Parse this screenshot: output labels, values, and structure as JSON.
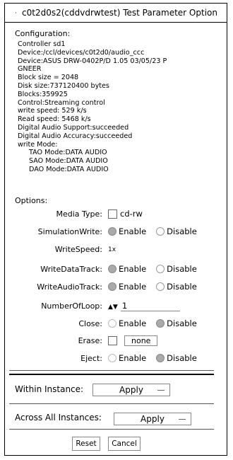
{
  "window": {
    "title": "c0t2d0s2(cddvdrwtest) Test Parameter Option"
  },
  "configuration": {
    "heading": "Configuration:",
    "lines": [
      "Controller sd1",
      "Device:/ccl/devices/c0t2d0/audio_ccc",
      "Device:ASUS    DRW-0402P/D      1.05 03/05/23 P",
      "GNEER",
      "Block size = 2048",
      "Disk size:737120400 bytes",
      "Blocks:359925",
      "Control:Streaming control",
      "write speed: 529 k/s",
      "Read speed: 5468 k/s",
      "Digital Audio Support:succeeded",
      "Digital Audio Accuracy:succeeded",
      "write Mode:",
      "TAO Mode:DATA   AUDIO",
      "SAO Mode:DATA   AUDIO",
      "DAO Mode:DATA   AUDIO"
    ]
  },
  "options": {
    "heading": "Options:",
    "media_type": {
      "label": "Media Type:",
      "value": "cd-rw"
    },
    "simulation_write": {
      "label": "SimulationWrite:",
      "enable": "Enable",
      "disable": "Disable",
      "selected": "Enable"
    },
    "write_speed": {
      "label": "WriteSpeed:",
      "value": "1x"
    },
    "write_data_track": {
      "label": "WriteDataTrack:",
      "enable": "Enable",
      "disable": "Disable",
      "selected": "Enable"
    },
    "write_audio_track": {
      "label": "WriteAudioTrack:",
      "enable": "Enable",
      "disable": "Disable",
      "selected": "Enable"
    },
    "number_of_loop": {
      "label": "NumberOfLoop:",
      "arrows": "▲▼",
      "value": "1"
    },
    "close": {
      "label": "Close:",
      "enable": "Enable",
      "disable": "Disable",
      "selected": "Disable"
    },
    "erase": {
      "label": "Erase:",
      "value": "none"
    },
    "eject": {
      "label": "Eject:",
      "enable": "Enable",
      "disable": "Disable",
      "selected": "Disable"
    }
  },
  "instances": {
    "within_label": "Within Instance:",
    "within_value": "Apply",
    "across_label": "Across All Instances:",
    "across_value": "Apply"
  },
  "footer": {
    "reset": "Reset",
    "cancel": "Cancel"
  }
}
